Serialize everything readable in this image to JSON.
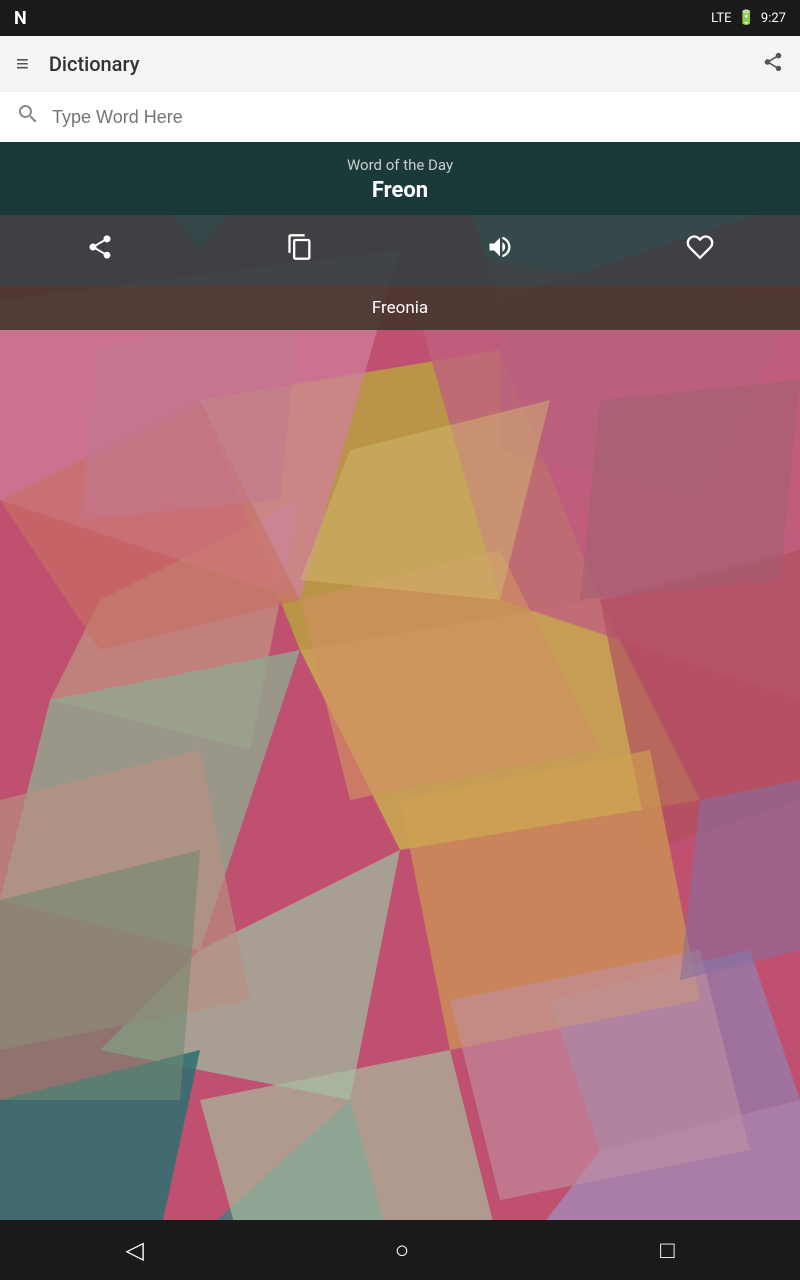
{
  "statusBar": {
    "logo": "N",
    "signal": "LTE",
    "battery": "🔋",
    "time": "9:27"
  },
  "appBar": {
    "menuIcon": "≡",
    "title": "Dictionary",
    "shareIcon": "⋮"
  },
  "search": {
    "placeholder": "Type Word Here",
    "searchIconLabel": "search-icon"
  },
  "wordOfTheDay": {
    "label": "Word of the Day",
    "word": "Freon"
  },
  "actions": {
    "share": "share-icon",
    "copy": "copy-icon",
    "audio": "audio-icon",
    "favorite": "heart-icon"
  },
  "related": {
    "word": "Freonia"
  },
  "navBar": {
    "back": "◁",
    "home": "○",
    "recent": "□"
  }
}
